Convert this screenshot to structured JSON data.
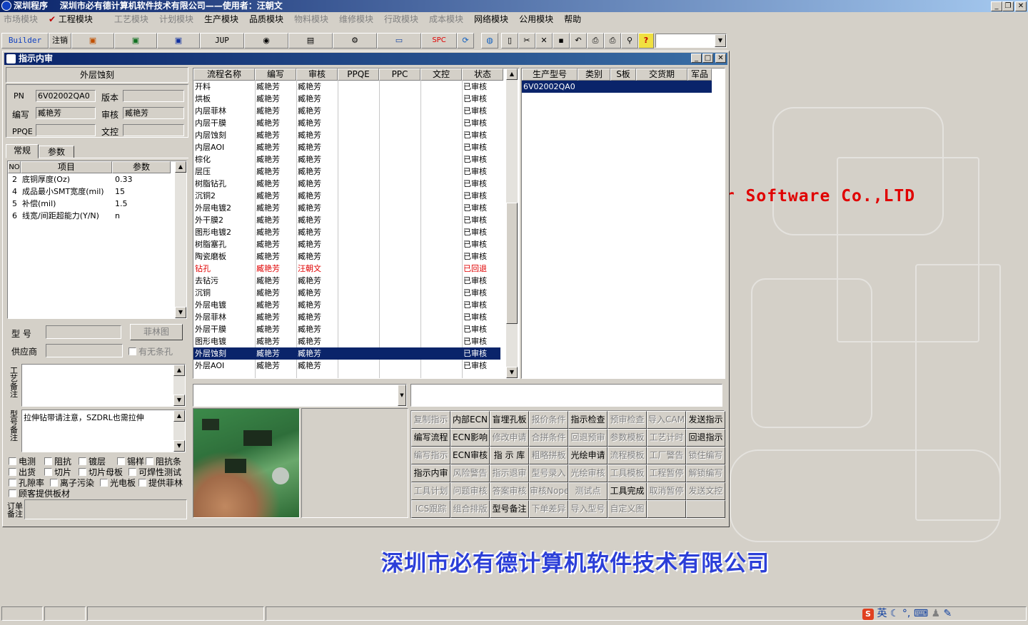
{
  "app": {
    "title": "深圳程序",
    "company_user": "深圳市必有德计算机软件技术有限公司——使用者：汪朝文"
  },
  "menu": [
    {
      "label": "市场模块",
      "enabled": false
    },
    {
      "label": "工程模块",
      "enabled": true,
      "checked": true
    },
    {
      "label": "工艺模块",
      "enabled": false
    },
    {
      "label": "计划模块",
      "enabled": false
    },
    {
      "label": "生产模块",
      "enabled": true
    },
    {
      "label": "品质模块",
      "enabled": true
    },
    {
      "label": "物料模块",
      "enabled": false
    },
    {
      "label": "维修模块",
      "enabled": false
    },
    {
      "label": "行政模块",
      "enabled": false
    },
    {
      "label": "成本模块",
      "enabled": false
    },
    {
      "label": "网络模块",
      "enabled": true
    },
    {
      "label": "公用模块",
      "enabled": true
    },
    {
      "label": "帮助",
      "enabled": true
    }
  ],
  "toolbar": {
    "builder": "Builder",
    "logout": "注销",
    "jup": "JUP",
    "spc": "SPC"
  },
  "desktop": {
    "brand_en": "er Software Co.,LTD",
    "brand_cn": "深圳市必有德计算机软件技术有限公司"
  },
  "window": {
    "title": "指示内审"
  },
  "left": {
    "header": "外层蚀刻",
    "pn_label": "PN",
    "pn_value": "6V02002QA0",
    "version_label": "版本",
    "version_value": "",
    "writer_label": "编写",
    "writer_value": "臧艳芳",
    "reviewer_label": "审核",
    "reviewer_value": "臧艳芳",
    "ppqe_label": "PPQE",
    "ppqe_value": "",
    "wenkong_label": "文控",
    "wenkong_value": "",
    "tabs": [
      "常规",
      "参数"
    ],
    "param_headers": [
      "NO",
      "项目",
      "参数"
    ],
    "params": [
      {
        "no": "2",
        "item": "底铜厚度(Oz)",
        "val": "0.33"
      },
      {
        "no": "4",
        "item": "成品最小SMT宽度(mil)",
        "val": "15"
      },
      {
        "no": "5",
        "item": "补偿(mil)",
        "val": "1.5"
      },
      {
        "no": "6",
        "item": "线宽/间距超能力(Y/N)",
        "val": "n"
      }
    ],
    "model_label": "型  号",
    "model_value": "",
    "feilin_button": "菲林图",
    "supplier_label": "供应商",
    "supplier_value": "",
    "has_slot_label": "有无条孔",
    "craft_note_label": "工艺备注",
    "craft_note": "",
    "model_note_label": "型号备注",
    "model_note": "拉伸钻带请注意，SZDRL也需拉伸",
    "checks": [
      [
        "电测",
        "阻抗",
        "镀层",
        "锡样",
        "阻抗条"
      ],
      [
        "出货",
        "切片",
        "切片母板",
        "可焊性测试"
      ],
      [
        "孔隙率",
        "离子污染",
        "光电板",
        "提供菲林"
      ],
      [
        "顾客提供板材"
      ]
    ],
    "order_note_label": "订单备注"
  },
  "flow": {
    "headers": [
      "流程名称",
      "编写",
      "审核",
      "PPQE",
      "PPC",
      "文控",
      "状态"
    ],
    "rows": [
      [
        "开料",
        "臧艳芳",
        "臧艳芳",
        "",
        "",
        "",
        "已审核"
      ],
      [
        "烘板",
        "臧艳芳",
        "臧艳芳",
        "",
        "",
        "",
        "已审核"
      ],
      [
        "内层菲林",
        "臧艳芳",
        "臧艳芳",
        "",
        "",
        "",
        "已审核"
      ],
      [
        "内层干膜",
        "臧艳芳",
        "臧艳芳",
        "",
        "",
        "",
        "已审核"
      ],
      [
        "内层蚀刻",
        "臧艳芳",
        "臧艳芳",
        "",
        "",
        "",
        "已审核"
      ],
      [
        "内层AOI",
        "臧艳芳",
        "臧艳芳",
        "",
        "",
        "",
        "已审核"
      ],
      [
        "棕化",
        "臧艳芳",
        "臧艳芳",
        "",
        "",
        "",
        "已审核"
      ],
      [
        "层压",
        "臧艳芳",
        "臧艳芳",
        "",
        "",
        "",
        "已审核"
      ],
      [
        "树脂钻孔",
        "臧艳芳",
        "臧艳芳",
        "",
        "",
        "",
        "已审核"
      ],
      [
        "沉铜2",
        "臧艳芳",
        "臧艳芳",
        "",
        "",
        "",
        "已审核"
      ],
      [
        "外层电镀2",
        "臧艳芳",
        "臧艳芳",
        "",
        "",
        "",
        "已审核"
      ],
      [
        "外干膜2",
        "臧艳芳",
        "臧艳芳",
        "",
        "",
        "",
        "已审核"
      ],
      [
        "图形电镀2",
        "臧艳芳",
        "臧艳芳",
        "",
        "",
        "",
        "已审核"
      ],
      [
        "树脂塞孔",
        "臧艳芳",
        "臧艳芳",
        "",
        "",
        "",
        "已审核"
      ],
      [
        "陶瓷磨板",
        "臧艳芳",
        "臧艳芳",
        "",
        "",
        "",
        "已审核"
      ],
      [
        "钻孔",
        "臧艳芳",
        "汪朝文",
        "",
        "",
        "",
        "已回退"
      ],
      [
        "去钻污",
        "臧艳芳",
        "臧艳芳",
        "",
        "",
        "",
        "已审核"
      ],
      [
        "沉铜",
        "臧艳芳",
        "臧艳芳",
        "",
        "",
        "",
        "已审核"
      ],
      [
        "外层电镀",
        "臧艳芳",
        "臧艳芳",
        "",
        "",
        "",
        "已审核"
      ],
      [
        "外层菲林",
        "臧艳芳",
        "臧艳芳",
        "",
        "",
        "",
        "已审核"
      ],
      [
        "外层干膜",
        "臧艳芳",
        "臧艳芳",
        "",
        "",
        "",
        "已审核"
      ],
      [
        "图形电镀",
        "臧艳芳",
        "臧艳芳",
        "",
        "",
        "",
        "已审核"
      ],
      [
        "外层蚀刻",
        "臧艳芳",
        "臧艳芳",
        "",
        "",
        "",
        "已审核"
      ],
      [
        "外层AOI",
        "臧艳芳",
        "臧艳芳",
        "",
        "",
        "",
        "已审核"
      ]
    ],
    "selected_index": 22,
    "returned_index": 15
  },
  "models": {
    "headers": [
      "生产型号",
      "类别",
      "S板",
      "交货期",
      "军品"
    ],
    "rows": [
      [
        "6V02002QA0",
        "",
        "",
        "",
        ""
      ]
    ]
  },
  "buttons": [
    [
      [
        "复制指示",
        false
      ],
      [
        "内部ECN",
        true
      ],
      [
        "盲埋孔板",
        true
      ],
      [
        "报价条件",
        false
      ],
      [
        "指示检查",
        true
      ],
      [
        "预审检查",
        false
      ],
      [
        "导入CAM",
        false
      ],
      [
        "发送指示",
        true
      ]
    ],
    [
      [
        "编写流程",
        true
      ],
      [
        "ECN影响",
        true
      ],
      [
        "修改申请",
        false
      ],
      [
        "合拼条件",
        false
      ],
      [
        "回退预审",
        false
      ],
      [
        "参数模板",
        false
      ],
      [
        "工艺计时",
        false
      ],
      [
        "回退指示",
        true
      ]
    ],
    [
      [
        "编写指示",
        false
      ],
      [
        "ECN审核",
        true
      ],
      [
        "指 示 库",
        true
      ],
      [
        "粗略拼板",
        false
      ],
      [
        "光绘申请",
        true
      ],
      [
        "流程模板",
        false
      ],
      [
        "工厂警告",
        false
      ],
      [
        "锁住编写",
        false
      ]
    ],
    [
      [
        "指示内审",
        true
      ],
      [
        "风险警告",
        false
      ],
      [
        "指示退审",
        false
      ],
      [
        "型号录入",
        false
      ],
      [
        "光绘审核",
        false
      ],
      [
        "工具模板",
        false
      ],
      [
        "工程暂停",
        false
      ],
      [
        "解锁编写",
        false
      ]
    ],
    [
      [
        "工具计划",
        false
      ],
      [
        "问题审核",
        false
      ],
      [
        "答案审核",
        false
      ],
      [
        "审核Nope",
        false
      ],
      [
        "测试点",
        false
      ],
      [
        "工具完成",
        true
      ],
      [
        "取消暂停",
        false
      ],
      [
        "发送文控",
        false
      ]
    ],
    [
      [
        "ICS跟踪",
        false
      ],
      [
        "组合排版",
        false
      ],
      [
        "型号备注",
        true
      ],
      [
        "下单差异",
        false
      ],
      [
        "导入型号",
        false
      ],
      [
        "自定义图",
        false
      ],
      [
        "",
        false
      ],
      [
        "",
        false
      ]
    ]
  ],
  "tray": {
    "ime": "英"
  }
}
